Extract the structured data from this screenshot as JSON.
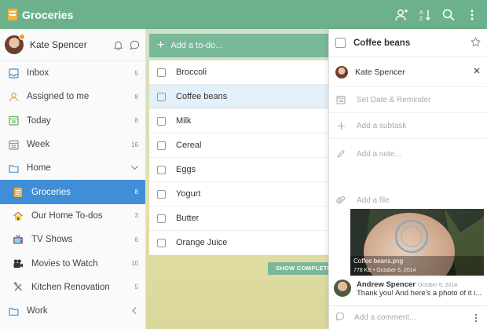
{
  "app": {
    "list_title": "Groceries"
  },
  "colors": {
    "topbar": "#6cb18b",
    "active": "#3f8ed7",
    "accent_yellow": "#f4b23f"
  },
  "topbar": {
    "icons": [
      "add-person-icon",
      "sort-icon",
      "search-icon",
      "more-vertical-icon"
    ]
  },
  "sidebar": {
    "user": {
      "name": "Kate Spencer"
    },
    "items": [
      {
        "label": "Inbox",
        "count": "5",
        "icon": "inbox-icon"
      },
      {
        "label": "Assigned to me",
        "count": "8",
        "icon": "person-icon"
      },
      {
        "label": "Today",
        "count": "8",
        "icon": "calendar-today-icon"
      },
      {
        "label": "Week",
        "count": "16",
        "icon": "calendar-week-icon"
      },
      {
        "label": "Home",
        "count": "",
        "icon": "folder-icon"
      },
      {
        "label": "Groceries",
        "count": "8",
        "icon": "list-icon"
      },
      {
        "label": "Our Home To-dos",
        "count": "3",
        "icon": "house-emoji-icon"
      },
      {
        "label": "TV Shows",
        "count": "6",
        "icon": "tv-emoji-icon"
      },
      {
        "label": "Movies to Watch",
        "count": "10",
        "icon": "camera-emoji-icon"
      },
      {
        "label": "Kitchen Renovation",
        "count": "5",
        "icon": "hammer-emoji-icon"
      },
      {
        "label": "Work",
        "count": "",
        "icon": "folder-icon"
      }
    ]
  },
  "main": {
    "add_placeholder": "Add a to-do...",
    "tasks": [
      "Broccoli",
      "Coffee beans",
      "Milk",
      "Cereal",
      "Eggs",
      "Yogurt",
      "Butter",
      "Orange Juice"
    ],
    "show_completed": "SHOW COMPLETED"
  },
  "detail": {
    "title": "Coffee beans",
    "assignee": "Kate Spencer",
    "set_date": "Set Date & Reminder",
    "add_subtask": "Add a subtask",
    "add_note": "Add a note...",
    "add_file": "Add a file",
    "file": {
      "name": "Coffee beans.png",
      "meta": "778 KB • October 6, 2014"
    },
    "comment": {
      "author": "Andrew Spencer",
      "date": "October 6, 2014",
      "text": "Thank you! And here's a photo of it i..."
    },
    "add_comment": "Add a comment..."
  }
}
